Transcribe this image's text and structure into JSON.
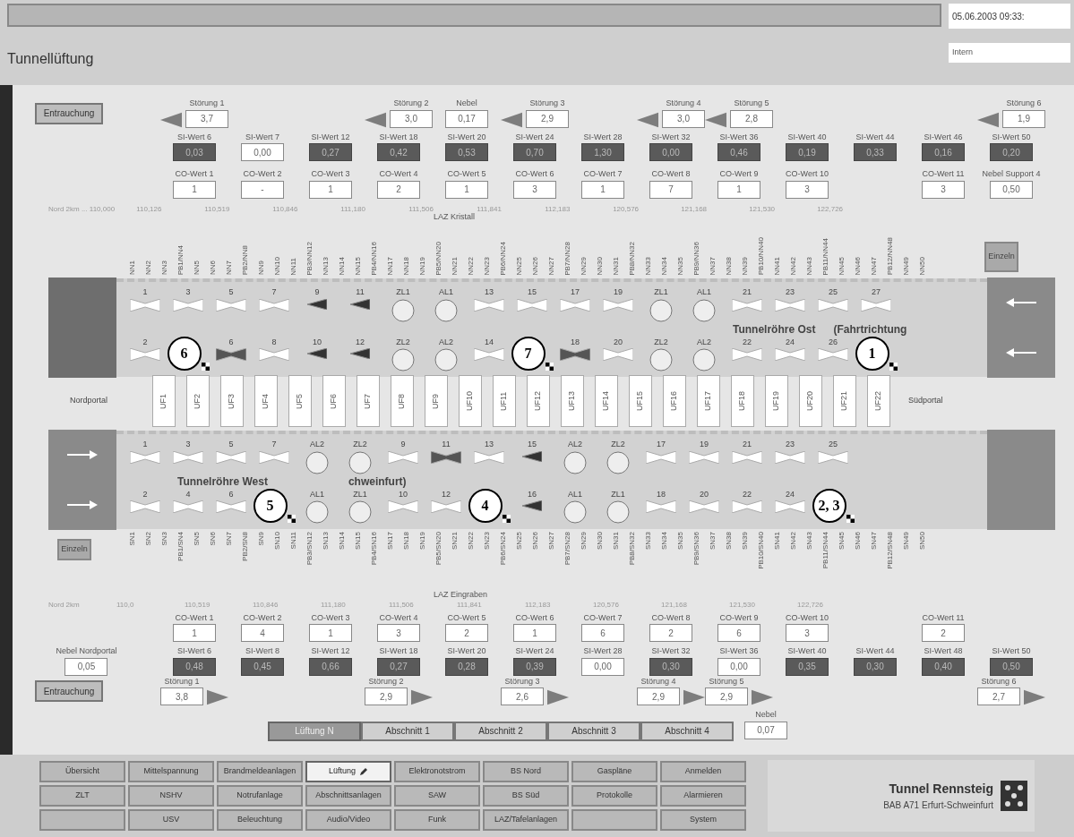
{
  "header": {
    "title": "Tunnellüftung",
    "datetime": "05.06.2003 09:33:",
    "user": "Intern"
  },
  "top": {
    "button": "Entrauchung",
    "faults": [
      {
        "label": "Störung 1",
        "value": "3,7"
      },
      {
        "label": "Störung 2",
        "value": "3,0"
      },
      {
        "label": "Störung 3",
        "value": "2,9"
      },
      {
        "label": "Störung 4",
        "value": "3,0"
      },
      {
        "label": "Störung 5",
        "value": "2,8"
      },
      {
        "label": "Störung 6",
        "value": "1,9"
      }
    ],
    "fog": {
      "label": "Nebel",
      "value": "0,17"
    },
    "si": [
      {
        "label": "SI-Wert 6",
        "value": "0,03",
        "alarm": true
      },
      {
        "label": "SI-Wert 7",
        "value": "0,00",
        "alarm": false
      },
      {
        "label": "SI-Wert 12",
        "value": "0,27",
        "alarm": true
      },
      {
        "label": "SI-Wert 18",
        "value": "0,42",
        "alarm": true
      },
      {
        "label": "SI-Wert 20",
        "value": "0,53",
        "alarm": true
      },
      {
        "label": "SI-Wert 24",
        "value": "0,70",
        "alarm": true
      },
      {
        "label": "SI-Wert 28",
        "value": "1,30",
        "alarm": true
      },
      {
        "label": "SI-Wert 32",
        "value": "0,00",
        "alarm": true
      },
      {
        "label": "SI-Wert 36",
        "value": "0,46",
        "alarm": true
      },
      {
        "label": "SI-Wert 40",
        "value": "0,19",
        "alarm": true
      },
      {
        "label": "SI-Wert 44",
        "value": "0,33",
        "alarm": true
      },
      {
        "label": "SI-Wert 46",
        "value": "0,16",
        "alarm": true
      },
      {
        "label": "SI-Wert 50",
        "value": "0,20",
        "alarm": true
      }
    ],
    "co": [
      {
        "label": "CO-Wert 1",
        "value": "1"
      },
      {
        "label": "CO-Wert 2",
        "value": "-"
      },
      {
        "label": "CO-Wert 3",
        "value": "1"
      },
      {
        "label": "CO-Wert 4",
        "value": "2"
      },
      {
        "label": "CO-Wert 5",
        "value": "1"
      },
      {
        "label": "CO-Wert 6",
        "value": "3"
      },
      {
        "label": "CO-Wert 7",
        "value": "1"
      },
      {
        "label": "CO-Wert 8",
        "value": "7"
      },
      {
        "label": "CO-Wert 9",
        "value": "1"
      },
      {
        "label": "CO-Wert 10",
        "value": "3"
      },
      {
        "label": "CO-Wert 11",
        "value": "3"
      }
    ],
    "fog_support": {
      "label": "Nebel Support 4",
      "value": "0,50"
    },
    "stations": [
      "Nord 2km ... 110,000",
      "110,126",
      "110,519",
      "110,846",
      "111,180",
      "111,506",
      "111,841",
      "112,183",
      "120,576",
      "121,168",
      "121,530",
      "122,726"
    ],
    "sensor_note": "LAZ Kristall",
    "sensors": [
      "NN1",
      "NN2",
      "NN3",
      "PB1/NN4",
      "NN5",
      "NN6",
      "NN7",
      "PB2/NN8",
      "NN9",
      "NN10",
      "NN11",
      "PB3/NN12",
      "NN13",
      "NN14",
      "NN15",
      "PB4/NN16",
      "NN17",
      "NN18",
      "NN19",
      "PB5/NN20",
      "NN21",
      "NN22",
      "NN23",
      "PB6/NN24",
      "NN25",
      "NN26",
      "NN27",
      "PB7/NN28",
      "NN29",
      "NN30",
      "NN31",
      "PB8/NN32",
      "NN33",
      "NN34",
      "NN35",
      "PB9/NN36",
      "NN37",
      "NN38",
      "NN39",
      "PB10/NN40",
      "NN41",
      "NN42",
      "NN43",
      "PB11/NN44",
      "NN45",
      "NN46",
      "NN47",
      "PB12/NN48",
      "NN49",
      "NN50"
    ],
    "side_button": "Einzeln"
  },
  "tubes": [
    {
      "title": "Tunnelröhre Ost",
      "title_tail": "(Fahrtrichtung",
      "portals": [
        {
          "kind": "closed"
        },
        {
          "kind": "westward"
        }
      ],
      "rows": [
        [
          {
            "kind": "fan",
            "label": "1",
            "running": false
          },
          {
            "kind": "fan",
            "label": "3",
            "running": false
          },
          {
            "kind": "fan",
            "label": "5",
            "running": false
          },
          {
            "kind": "fan",
            "label": "7",
            "running": false
          },
          {
            "kind": "jet",
            "label": "9",
            "running": true
          },
          {
            "kind": "jet",
            "label": "11",
            "running": true
          },
          {
            "kind": "sensor",
            "label": "ZL1",
            "running": false
          },
          {
            "kind": "sensor",
            "label": "AL1",
            "running": false
          },
          {
            "kind": "fan",
            "label": "13",
            "running": false
          },
          {
            "kind": "fan",
            "label": "15",
            "running": false
          },
          {
            "kind": "fan",
            "label": "17",
            "running": false
          },
          {
            "kind": "fan",
            "label": "19",
            "running": false
          },
          {
            "kind": "sensor",
            "label": "ZL1",
            "running": false
          },
          {
            "kind": "sensor",
            "label": "AL1",
            "running": false
          },
          {
            "kind": "fan",
            "label": "21",
            "running": false
          },
          {
            "kind": "fan",
            "label": "23",
            "running": false
          },
          {
            "kind": "fan",
            "label": "25",
            "running": false
          },
          {
            "kind": "fan",
            "label": "27",
            "running": false
          }
        ],
        [
          {
            "kind": "fan",
            "label": "2",
            "running": false
          },
          {
            "kind": "marker",
            "label": "6"
          },
          {
            "kind": "fan",
            "label": "6",
            "running": true
          },
          {
            "kind": "fan",
            "label": "8",
            "running": false
          },
          {
            "kind": "jet",
            "label": "10",
            "running": true
          },
          {
            "kind": "jet",
            "label": "12",
            "running": true
          },
          {
            "kind": "sensor",
            "label": "ZL2",
            "running": false
          },
          {
            "kind": "sensor",
            "label": "AL2",
            "running": false
          },
          {
            "kind": "fan",
            "label": "14",
            "running": false
          },
          {
            "kind": "marker",
            "label": "7"
          },
          {
            "kind": "fan",
            "label": "18",
            "running": true
          },
          {
            "kind": "fan",
            "label": "20",
            "running": false
          },
          {
            "kind": "sensor",
            "label": "ZL2",
            "running": false
          },
          {
            "kind": "sensor",
            "label": "AL2",
            "running": false
          },
          {
            "kind": "fan",
            "label": "22",
            "running": false
          },
          {
            "kind": "fan",
            "label": "24",
            "running": false
          },
          {
            "kind": "fan",
            "label": "26",
            "running": false
          },
          {
            "kind": "marker",
            "label": "1"
          }
        ]
      ]
    },
    {
      "title": "Tunnelröhre West",
      "title_tail": "chweinfurt)",
      "portals": [
        {
          "kind": "eastward"
        },
        {
          "kind": "plain"
        }
      ],
      "rows": [
        [
          {
            "kind": "fan",
            "label": "1",
            "running": false
          },
          {
            "kind": "fan",
            "label": "3",
            "running": false
          },
          {
            "kind": "fan",
            "label": "5",
            "running": false
          },
          {
            "kind": "fan",
            "label": "7",
            "running": false
          },
          {
            "kind": "sensor",
            "label": "AL2",
            "running": false
          },
          {
            "kind": "sensor",
            "label": "ZL2",
            "running": false
          },
          {
            "kind": "fan",
            "label": "9",
            "running": false
          },
          {
            "kind": "fan",
            "label": "11",
            "running": true
          },
          {
            "kind": "fan",
            "label": "13",
            "running": false
          },
          {
            "kind": "jet",
            "label": "15",
            "running": true
          },
          {
            "kind": "sensor",
            "label": "AL2",
            "running": false
          },
          {
            "kind": "sensor",
            "label": "ZL2",
            "running": false
          },
          {
            "kind": "fan",
            "label": "17",
            "running": false
          },
          {
            "kind": "fan",
            "label": "19",
            "running": false
          },
          {
            "kind": "fan",
            "label": "21",
            "running": false
          },
          {
            "kind": "fan",
            "label": "23",
            "running": false
          },
          {
            "kind": "fan",
            "label": "25",
            "running": false
          }
        ],
        [
          {
            "kind": "fan",
            "label": "2",
            "running": false
          },
          {
            "kind": "fan",
            "label": "4",
            "running": false
          },
          {
            "kind": "fan",
            "label": "6",
            "running": false
          },
          {
            "kind": "marker",
            "label": "5"
          },
          {
            "kind": "sensor",
            "label": "AL1",
            "running": false
          },
          {
            "kind": "sensor",
            "label": "ZL1",
            "running": false
          },
          {
            "kind": "fan",
            "label": "10",
            "running": false
          },
          {
            "kind": "fan",
            "label": "12",
            "running": false
          },
          {
            "kind": "marker",
            "label": "4"
          },
          {
            "kind": "jet",
            "label": "16",
            "running": true
          },
          {
            "kind": "sensor",
            "label": "AL1",
            "running": false
          },
          {
            "kind": "sensor",
            "label": "ZL1",
            "running": false
          },
          {
            "kind": "fan",
            "label": "18",
            "running": false
          },
          {
            "kind": "fan",
            "label": "20",
            "running": false
          },
          {
            "kind": "fan",
            "label": "22",
            "running": false
          },
          {
            "kind": "fan",
            "label": "24",
            "running": false
          },
          {
            "kind": "marker",
            "label": "2, 3"
          }
        ]
      ]
    }
  ],
  "crossing": {
    "north": "Nordportal",
    "south": "Südportal",
    "passages": [
      "UF1",
      "UF2",
      "UF3",
      "UF4",
      "UF5",
      "UF6",
      "UF7",
      "UF8",
      "UF9",
      "UF10",
      "UF11",
      "UF12",
      "UF13",
      "UF14",
      "UF15",
      "UF16",
      "UF17",
      "UF18",
      "UF19",
      "UF20",
      "UF21",
      "UF22"
    ]
  },
  "bottom": {
    "side_button": "Einzeln",
    "sensor_note": "LAZ Eingraben",
    "sensors": [
      "SN1",
      "SN2",
      "SN3",
      "PB1/SN4",
      "SN5",
      "SN6",
      "SN7",
      "PB2/SN8",
      "SN9",
      "SN10",
      "SN11",
      "PB3/SN12",
      "SN13",
      "SN14",
      "SN15",
      "PB4/SN16",
      "SN17",
      "SN18",
      "SN19",
      "PB5/SN20",
      "SN21",
      "SN22",
      "SN23",
      "PB6/SN24",
      "SN25",
      "SN26",
      "SN27",
      "PB7/SN28",
      "SN29",
      "SN30",
      "SN31",
      "PB8/SN32",
      "SN33",
      "SN34",
      "SN35",
      "PB9/SN36",
      "SN37",
      "SN38",
      "SN39",
      "PB10/SN40",
      "SN41",
      "SN42",
      "SN43",
      "PB11/SN44",
      "SN45",
      "SN46",
      "SN47",
      "PB12/SN48",
      "SN49",
      "SN50"
    ],
    "stations": [
      "Nord 2km",
      "110,0",
      "110,519",
      "110,846",
      "111,180",
      "111,506",
      "111,841",
      "112,183",
      "120,576",
      "121,168",
      "121,530",
      "122,726"
    ],
    "co": [
      {
        "label": "CO-Wert 1",
        "value": "1"
      },
      {
        "label": "CO-Wert 2",
        "value": "4"
      },
      {
        "label": "CO-Wert 3",
        "value": "1"
      },
      {
        "label": "CO-Wert 4",
        "value": "3"
      },
      {
        "label": "CO-Wert 5",
        "value": "2"
      },
      {
        "label": "CO-Wert 6",
        "value": "1"
      },
      {
        "label": "CO-Wert 7",
        "value": "6"
      },
      {
        "label": "CO-Wert 8",
        "value": "2"
      },
      {
        "label": "CO-Wert 9",
        "value": "6"
      },
      {
        "label": "CO-Wert 10",
        "value": "3"
      },
      {
        "label": "CO-Wert 11",
        "value": "2"
      }
    ],
    "fog_portal": {
      "label": "Nebel Nordportal",
      "value": "0,05"
    },
    "si": [
      {
        "label": "SI-Wert 6",
        "value": "0,48",
        "alarm": true
      },
      {
        "label": "SI-Wert 8",
        "value": "0,45",
        "alarm": true
      },
      {
        "label": "SI-Wert 12",
        "value": "0,66",
        "alarm": true
      },
      {
        "label": "SI-Wert 18",
        "value": "0,27",
        "alarm": true
      },
      {
        "label": "SI-Wert 20",
        "value": "0,28",
        "alarm": true
      },
      {
        "label": "SI-Wert 24",
        "value": "0,39",
        "alarm": true
      },
      {
        "label": "SI-Wert 28",
        "value": "0,00",
        "alarm": false
      },
      {
        "label": "SI-Wert 32",
        "value": "0,30",
        "alarm": true
      },
      {
        "label": "SI-Wert 36",
        "value": "0,00",
        "alarm": false
      },
      {
        "label": "SI-Wert 40",
        "value": "0,35",
        "alarm": true
      },
      {
        "label": "SI-Wert 44",
        "value": "0,30",
        "alarm": true
      },
      {
        "label": "SI-Wert 48",
        "value": "0,40",
        "alarm": true
      },
      {
        "label": "SI-Wert 50",
        "value": "0,50",
        "alarm": true
      }
    ],
    "button": "Entrauchung",
    "faults": [
      {
        "label": "Störung 1",
        "value": "3,8"
      },
      {
        "label": "Störung 2",
        "value": "2,9"
      },
      {
        "label": "Störung 3",
        "value": "2,6"
      },
      {
        "label": "Störung 4",
        "value": "2,9"
      },
      {
        "label": "Störung 5",
        "value": "2,9"
      },
      {
        "label": "Störung 6",
        "value": "2,7"
      }
    ],
    "fog": {
      "label": "Nebel",
      "value": "0,07"
    }
  },
  "tabs": [
    {
      "label": "Lüftung N",
      "selected": true
    },
    {
      "label": "Abschnitt 1",
      "selected": false
    },
    {
      "label": "Abschnitt 2",
      "selected": false
    },
    {
      "label": "Abschnitt 3",
      "selected": false
    },
    {
      "label": "Abschnitt 4",
      "selected": false
    }
  ],
  "nav": [
    [
      {
        "label": "Übersicht",
        "selected": false
      },
      {
        "label": "Mittelspannung",
        "selected": false
      },
      {
        "label": "Brandmeldeanlagen",
        "selected": false
      },
      {
        "label": "Lüftung",
        "selected": true
      },
      {
        "label": "Elektronotstrom",
        "selected": false
      },
      {
        "label": "BS Nord",
        "selected": false
      },
      {
        "label": "Gaspläne",
        "selected": false
      },
      {
        "label": "Anmelden",
        "selected": false
      }
    ],
    [
      {
        "label": "ZLT",
        "selected": false
      },
      {
        "label": "NSHV",
        "selected": false
      },
      {
        "label": "Notrufanlage",
        "selected": false
      },
      {
        "label": "Abschnittsanlagen",
        "selected": false
      },
      {
        "label": "SAW",
        "selected": false
      },
      {
        "label": "BS Süd",
        "selected": false
      },
      {
        "label": "Protokolle",
        "selected": false
      },
      {
        "label": "Alarmieren",
        "selected": false
      }
    ],
    [
      {
        "selected": false
      },
      {
        "label": "USV",
        "selected": false
      },
      {
        "label": "Beleuchtung",
        "selected": false
      },
      {
        "label": "Audio/Video",
        "selected": false
      },
      {
        "label": "Funk",
        "selected": false
      },
      {
        "label": "LAZ/Tafelanlagen",
        "selected": false
      },
      {
        "selected": false
      },
      {
        "label": "System",
        "selected": false
      }
    ]
  ],
  "brand": {
    "name": "Tunnel Rennsteig",
    "route": "BAB A71 Erfurt-Schweinfurt"
  }
}
